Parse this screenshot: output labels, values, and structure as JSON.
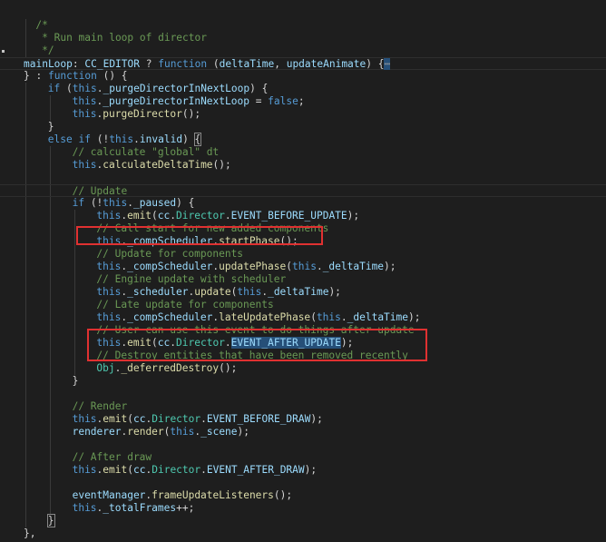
{
  "lines": [
    {
      "indent": 0,
      "tokens": []
    },
    {
      "indent": 2,
      "tokens": [
        [
          "com",
          "/*"
        ]
      ]
    },
    {
      "indent": 2,
      "tokens": [
        [
          "com",
          " * Run main loop of director"
        ]
      ]
    },
    {
      "indent": 2,
      "tokens": [
        [
          "com",
          " */"
        ]
      ]
    },
    {
      "indent": 0,
      "current": true,
      "tokens": [
        [
          "var",
          "mainLoop"
        ],
        [
          "plain",
          ": "
        ],
        [
          "var",
          "CC_EDITOR"
        ],
        [
          "plain",
          " ? "
        ],
        [
          "kw",
          "function"
        ],
        [
          "plain",
          " ("
        ],
        [
          "var",
          "deltaTime"
        ],
        [
          "plain",
          ", "
        ],
        [
          "var",
          "updateAnimate"
        ],
        [
          "plain",
          ") {"
        ],
        [
          "fold",
          "⋯"
        ]
      ]
    },
    {
      "indent": 0,
      "tokens": [
        [
          "plain",
          "} : "
        ],
        [
          "kw",
          "function"
        ],
        [
          "plain",
          " () {"
        ]
      ]
    },
    {
      "indent": 4,
      "tokens": [
        [
          "kw",
          "if"
        ],
        [
          "plain",
          " ("
        ],
        [
          "kw",
          "this"
        ],
        [
          "plain",
          "."
        ],
        [
          "var",
          "_purgeDirectorInNextLoop"
        ],
        [
          "plain",
          ") {"
        ]
      ]
    },
    {
      "indent": 8,
      "tokens": [
        [
          "kw",
          "this"
        ],
        [
          "plain",
          "."
        ],
        [
          "var",
          "_purgeDirectorInNextLoop"
        ],
        [
          "plain",
          " = "
        ],
        [
          "kw",
          "false"
        ],
        [
          "plain",
          ";"
        ]
      ]
    },
    {
      "indent": 8,
      "tokens": [
        [
          "kw",
          "this"
        ],
        [
          "plain",
          "."
        ],
        [
          "fn",
          "purgeDirector"
        ],
        [
          "plain",
          "();"
        ]
      ]
    },
    {
      "indent": 4,
      "tokens": [
        [
          "plain",
          "}"
        ]
      ]
    },
    {
      "indent": 4,
      "tokens": [
        [
          "kw",
          "else"
        ],
        [
          "plain",
          " "
        ],
        [
          "kw",
          "if"
        ],
        [
          "plain",
          " (!"
        ],
        [
          "kw",
          "this"
        ],
        [
          "plain",
          "."
        ],
        [
          "var",
          "invalid"
        ],
        [
          "plain",
          ") "
        ],
        [
          "box",
          "{"
        ]
      ]
    },
    {
      "indent": 8,
      "tokens": [
        [
          "com",
          "// calculate \"global\" dt"
        ]
      ]
    },
    {
      "indent": 8,
      "tokens": [
        [
          "kw",
          "this"
        ],
        [
          "plain",
          "."
        ],
        [
          "fn",
          "calculateDeltaTime"
        ],
        [
          "plain",
          "();"
        ]
      ]
    },
    {
      "indent": 0,
      "tokens": []
    },
    {
      "indent": 8,
      "current": true,
      "tokens": [
        [
          "com",
          "// Update"
        ]
      ]
    },
    {
      "indent": 8,
      "tokens": [
        [
          "kw",
          "if"
        ],
        [
          "plain",
          " (!"
        ],
        [
          "kw",
          "this"
        ],
        [
          "plain",
          "."
        ],
        [
          "var",
          "_paused"
        ],
        [
          "plain",
          ") {"
        ]
      ]
    },
    {
      "indent": 12,
      "tokens": [
        [
          "kw",
          "this"
        ],
        [
          "plain",
          "."
        ],
        [
          "fn",
          "emit"
        ],
        [
          "plain",
          "("
        ],
        [
          "var",
          "cc"
        ],
        [
          "plain",
          "."
        ],
        [
          "type",
          "Director"
        ],
        [
          "plain",
          "."
        ],
        [
          "var",
          "EVENT_BEFORE_UPDATE"
        ],
        [
          "plain",
          ");"
        ]
      ]
    },
    {
      "indent": 12,
      "tokens": [
        [
          "com",
          "// Call start for new added components"
        ]
      ]
    },
    {
      "indent": 12,
      "tokens": [
        [
          "kw",
          "this"
        ],
        [
          "plain",
          "."
        ],
        [
          "var",
          "_compScheduler"
        ],
        [
          "plain",
          "."
        ],
        [
          "fn",
          "startPhase"
        ],
        [
          "plain",
          "();"
        ]
      ]
    },
    {
      "indent": 12,
      "tokens": [
        [
          "com",
          "// Update for components"
        ]
      ]
    },
    {
      "indent": 12,
      "tokens": [
        [
          "kw",
          "this"
        ],
        [
          "plain",
          "."
        ],
        [
          "var",
          "_compScheduler"
        ],
        [
          "plain",
          "."
        ],
        [
          "fn",
          "updatePhase"
        ],
        [
          "plain",
          "("
        ],
        [
          "kw",
          "this"
        ],
        [
          "plain",
          "."
        ],
        [
          "var",
          "_deltaTime"
        ],
        [
          "plain",
          ");"
        ]
      ]
    },
    {
      "indent": 12,
      "tokens": [
        [
          "com",
          "// Engine update with scheduler"
        ]
      ]
    },
    {
      "indent": 12,
      "tokens": [
        [
          "kw",
          "this"
        ],
        [
          "plain",
          "."
        ],
        [
          "var",
          "_scheduler"
        ],
        [
          "plain",
          "."
        ],
        [
          "fn",
          "update"
        ],
        [
          "plain",
          "("
        ],
        [
          "kw",
          "this"
        ],
        [
          "plain",
          "."
        ],
        [
          "var",
          "_deltaTime"
        ],
        [
          "plain",
          ");"
        ]
      ]
    },
    {
      "indent": 12,
      "tokens": [
        [
          "com",
          "// Late update for components"
        ]
      ]
    },
    {
      "indent": 12,
      "tokens": [
        [
          "kw",
          "this"
        ],
        [
          "plain",
          "."
        ],
        [
          "var",
          "_compScheduler"
        ],
        [
          "plain",
          "."
        ],
        [
          "fn",
          "lateUpdatePhase"
        ],
        [
          "plain",
          "("
        ],
        [
          "kw",
          "this"
        ],
        [
          "plain",
          "."
        ],
        [
          "var",
          "_deltaTime"
        ],
        [
          "plain",
          ");"
        ]
      ]
    },
    {
      "indent": 12,
      "tokens": [
        [
          "com",
          "// User can use this event to do things after update"
        ]
      ]
    },
    {
      "indent": 12,
      "tokens": [
        [
          "kw",
          "this"
        ],
        [
          "plain",
          "."
        ],
        [
          "fn",
          "emit"
        ],
        [
          "plain",
          "("
        ],
        [
          "var",
          "cc"
        ],
        [
          "plain",
          "."
        ],
        [
          "type",
          "Director"
        ],
        [
          "plain",
          "."
        ],
        [
          "sel",
          "EVENT_AFTER_UPDATE"
        ],
        [
          "plain",
          ");"
        ]
      ]
    },
    {
      "indent": 12,
      "tokens": [
        [
          "com",
          "// Destroy entities that have been removed recently"
        ]
      ]
    },
    {
      "indent": 12,
      "tokens": [
        [
          "type",
          "Obj"
        ],
        [
          "plain",
          "."
        ],
        [
          "fn",
          "_deferredDestroy"
        ],
        [
          "plain",
          "();"
        ]
      ]
    },
    {
      "indent": 8,
      "tokens": [
        [
          "plain",
          "}"
        ]
      ]
    },
    {
      "indent": 0,
      "tokens": []
    },
    {
      "indent": 8,
      "tokens": [
        [
          "com",
          "// Render"
        ]
      ]
    },
    {
      "indent": 8,
      "tokens": [
        [
          "kw",
          "this"
        ],
        [
          "plain",
          "."
        ],
        [
          "fn",
          "emit"
        ],
        [
          "plain",
          "("
        ],
        [
          "var",
          "cc"
        ],
        [
          "plain",
          "."
        ],
        [
          "type",
          "Director"
        ],
        [
          "plain",
          "."
        ],
        [
          "var",
          "EVENT_BEFORE_DRAW"
        ],
        [
          "plain",
          ");"
        ]
      ]
    },
    {
      "indent": 8,
      "tokens": [
        [
          "var",
          "renderer"
        ],
        [
          "plain",
          "."
        ],
        [
          "fn",
          "render"
        ],
        [
          "plain",
          "("
        ],
        [
          "kw",
          "this"
        ],
        [
          "plain",
          "."
        ],
        [
          "var",
          "_scene"
        ],
        [
          "plain",
          ");"
        ]
      ]
    },
    {
      "indent": 0,
      "tokens": []
    },
    {
      "indent": 8,
      "tokens": [
        [
          "com",
          "// After draw"
        ]
      ]
    },
    {
      "indent": 8,
      "tokens": [
        [
          "kw",
          "this"
        ],
        [
          "plain",
          "."
        ],
        [
          "fn",
          "emit"
        ],
        [
          "plain",
          "("
        ],
        [
          "var",
          "cc"
        ],
        [
          "plain",
          "."
        ],
        [
          "type",
          "Director"
        ],
        [
          "plain",
          "."
        ],
        [
          "var",
          "EVENT_AFTER_DRAW"
        ],
        [
          "plain",
          ");"
        ]
      ]
    },
    {
      "indent": 0,
      "tokens": []
    },
    {
      "indent": 8,
      "tokens": [
        [
          "var",
          "eventManager"
        ],
        [
          "plain",
          "."
        ],
        [
          "fn",
          "frameUpdateListeners"
        ],
        [
          "plain",
          "();"
        ]
      ]
    },
    {
      "indent": 8,
      "tokens": [
        [
          "kw",
          "this"
        ],
        [
          "plain",
          "."
        ],
        [
          "var",
          "_totalFrames"
        ],
        [
          "plain",
          "++;"
        ]
      ]
    },
    {
      "indent": 4,
      "tokens": [
        [
          "box",
          "}"
        ]
      ]
    },
    {
      "indent": 0,
      "tokens": [
        [
          "plain",
          "},"
        ]
      ]
    }
  ],
  "colors": {
    "background": "#1e1e1e",
    "highlight_box": "#e03131"
  }
}
